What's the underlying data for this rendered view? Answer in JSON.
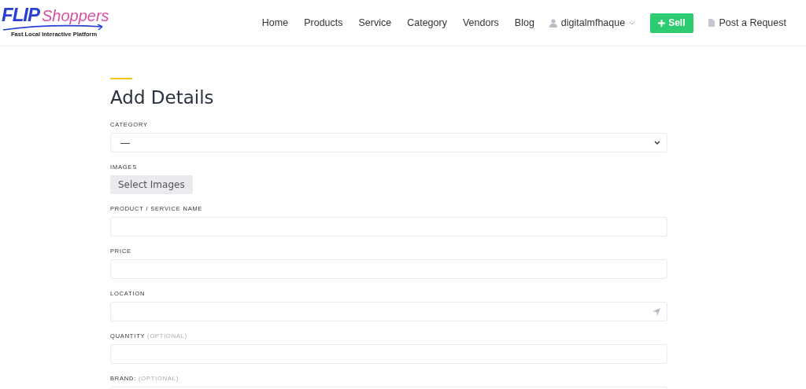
{
  "logo": {
    "brand_first": "FLIP",
    "brand_second": "Shoppers",
    "tagline": "Fast Local Interactive Platform"
  },
  "nav": {
    "links": [
      "Home",
      "Products",
      "Service",
      "Category",
      "Vendors",
      "Blog"
    ],
    "user": "digitalmfhaque",
    "sell_button": "Sell",
    "request_link": "Post a Request"
  },
  "form": {
    "title": "Add Details",
    "fields": [
      {
        "kind": "select",
        "label": "CATEGORY",
        "value": "—"
      },
      {
        "kind": "button",
        "label": "IMAGES",
        "button": "Select Images"
      },
      {
        "kind": "text",
        "label": "PRODUCT / SERVICE NAME"
      },
      {
        "kind": "text",
        "label": "PRICE"
      },
      {
        "kind": "location",
        "label": "LOCATION"
      },
      {
        "kind": "text",
        "label": "QUANTITY",
        "note": "(OPTIONAL)"
      },
      {
        "kind": "text",
        "label": "BRAND:",
        "note": "(OPTIONAL)"
      }
    ]
  }
}
